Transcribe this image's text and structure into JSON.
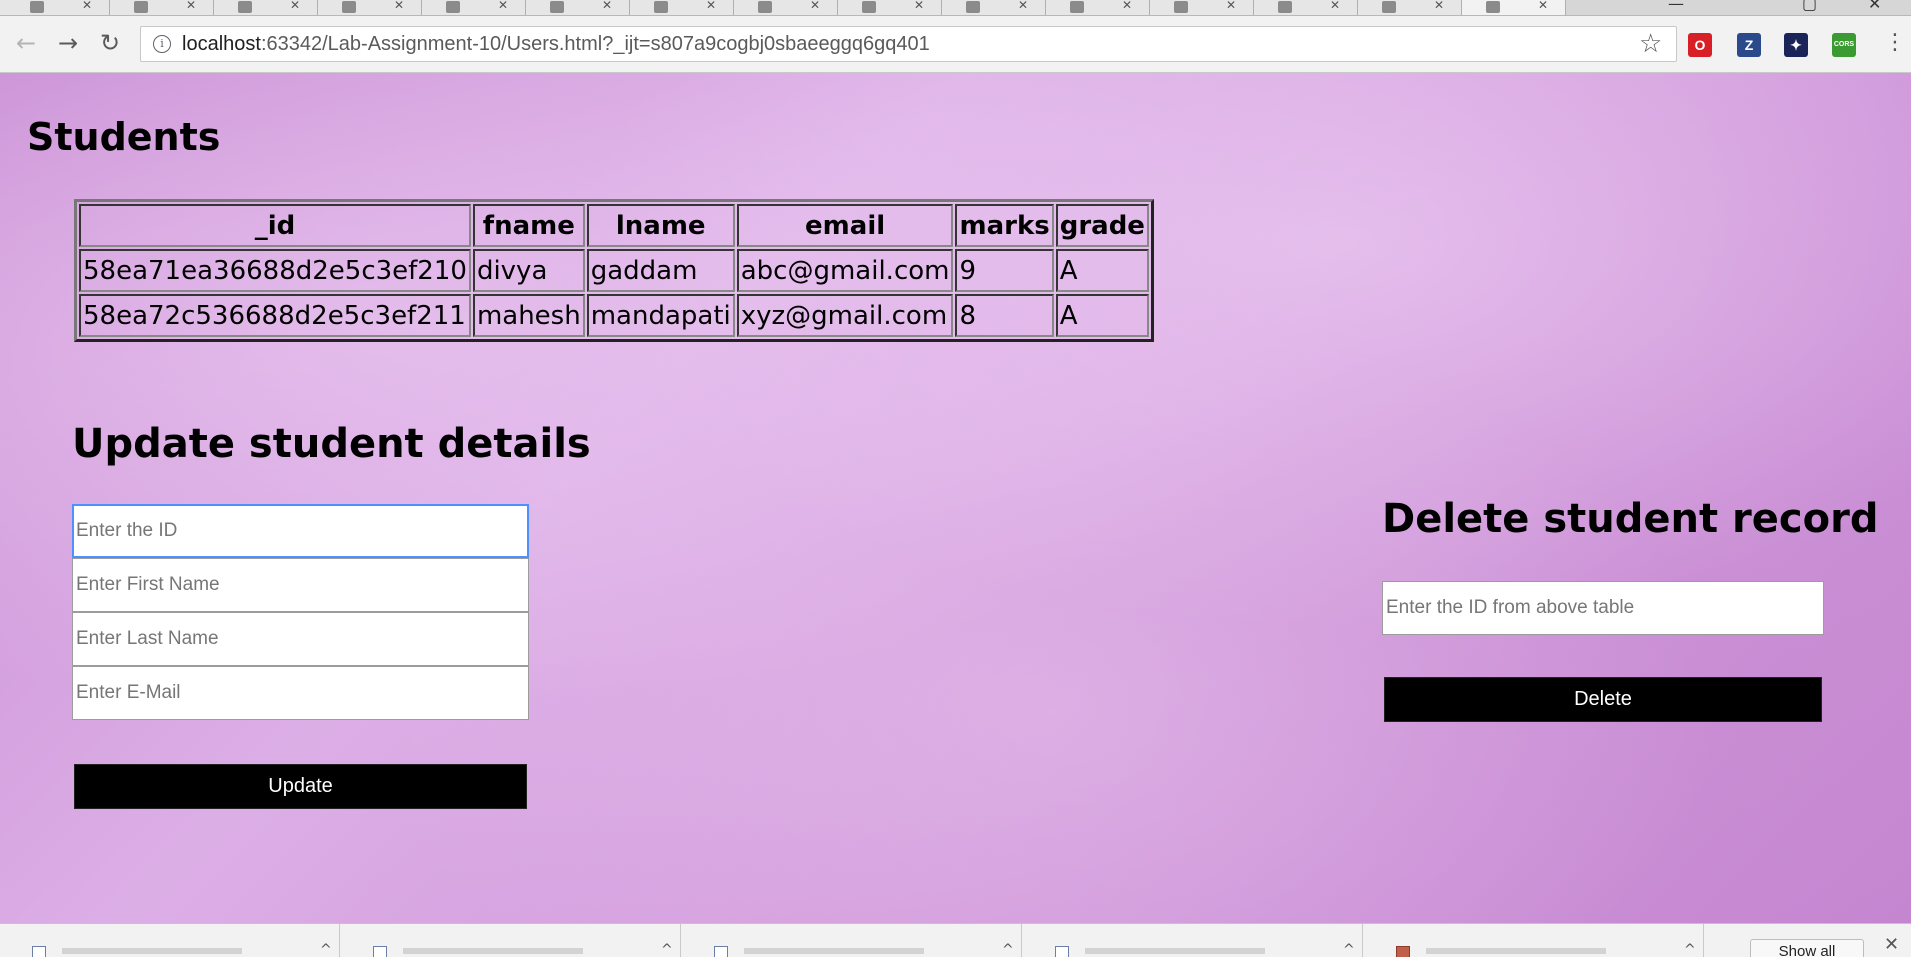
{
  "browser": {
    "tabs_count": 15,
    "url_host": "localhost",
    "url_rest": ":63342/Lab-Assignment-10/Users.html?_ijt=s807a9cogbj0sbaeeggq6gq401",
    "extensions": [
      {
        "name": "opera-extension-icon",
        "glyph": "O",
        "color": "#d81f26"
      },
      {
        "name": "zotero-extension-icon",
        "glyph": "Z",
        "color": "#2a4a8c"
      },
      {
        "name": "space-extension-icon",
        "glyph": "✦",
        "color": "#1b2458"
      },
      {
        "name": "cors-extension-icon",
        "glyph": "CORS",
        "color": "#3c9a33"
      }
    ]
  },
  "students_section": {
    "title": "Students",
    "columns": [
      "_id",
      "fname",
      "lname",
      "email",
      "marks",
      "grade"
    ],
    "rows": [
      [
        "58ea71ea36688d2e5c3ef210",
        "divya",
        "gaddam",
        "abc@gmail.com",
        "9",
        "A"
      ],
      [
        "58ea72c536688d2e5c3ef211",
        "mahesh",
        "mandapati",
        "xyz@gmail.com",
        "8",
        "A"
      ]
    ]
  },
  "update_section": {
    "title": "Update student details",
    "id_placeholder": "Enter the ID",
    "fname_placeholder": "Enter First Name",
    "lname_placeholder": "Enter Last Name",
    "email_placeholder": "Enter E-Mail",
    "button_label": "Update"
  },
  "delete_section": {
    "title": "Delete student record",
    "id_placeholder": "Enter the ID from above table",
    "button_label": "Delete"
  },
  "download_bar": {
    "show_all_label": "Show all"
  }
}
